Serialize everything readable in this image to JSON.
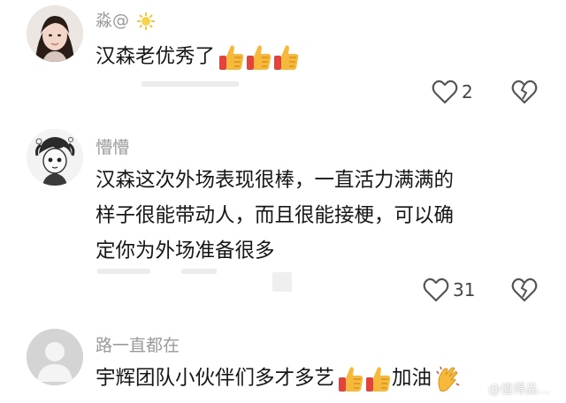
{
  "comments": [
    {
      "username": "淼@",
      "username_icon": "sun-icon",
      "text": "汉森老优秀了",
      "emojis": [
        "thumbs-up-icon",
        "thumbs-up-icon",
        "thumbs-up-icon"
      ],
      "likes": "2",
      "avatar": "avatar-photo-woman"
    },
    {
      "username": "懵懵",
      "text_lines": [
        "汉森这次外场表现很棒，一直活力满满的",
        "样子很能带动人，而且很能接梗，可以确",
        "定你为外场准备很多"
      ],
      "likes": "31",
      "avatar": "avatar-illustration"
    },
    {
      "username": "路一直都在",
      "text": "宇辉团队小伙伴们多才多艺",
      "emojis": [
        "thumbs-up-icon",
        "thumbs-up-icon"
      ],
      "text_suffix": "加油",
      "suffix_emoji": "clapping-hands-icon",
      "avatar": "avatar-default-gray"
    }
  ],
  "watermark": "@值得品…"
}
